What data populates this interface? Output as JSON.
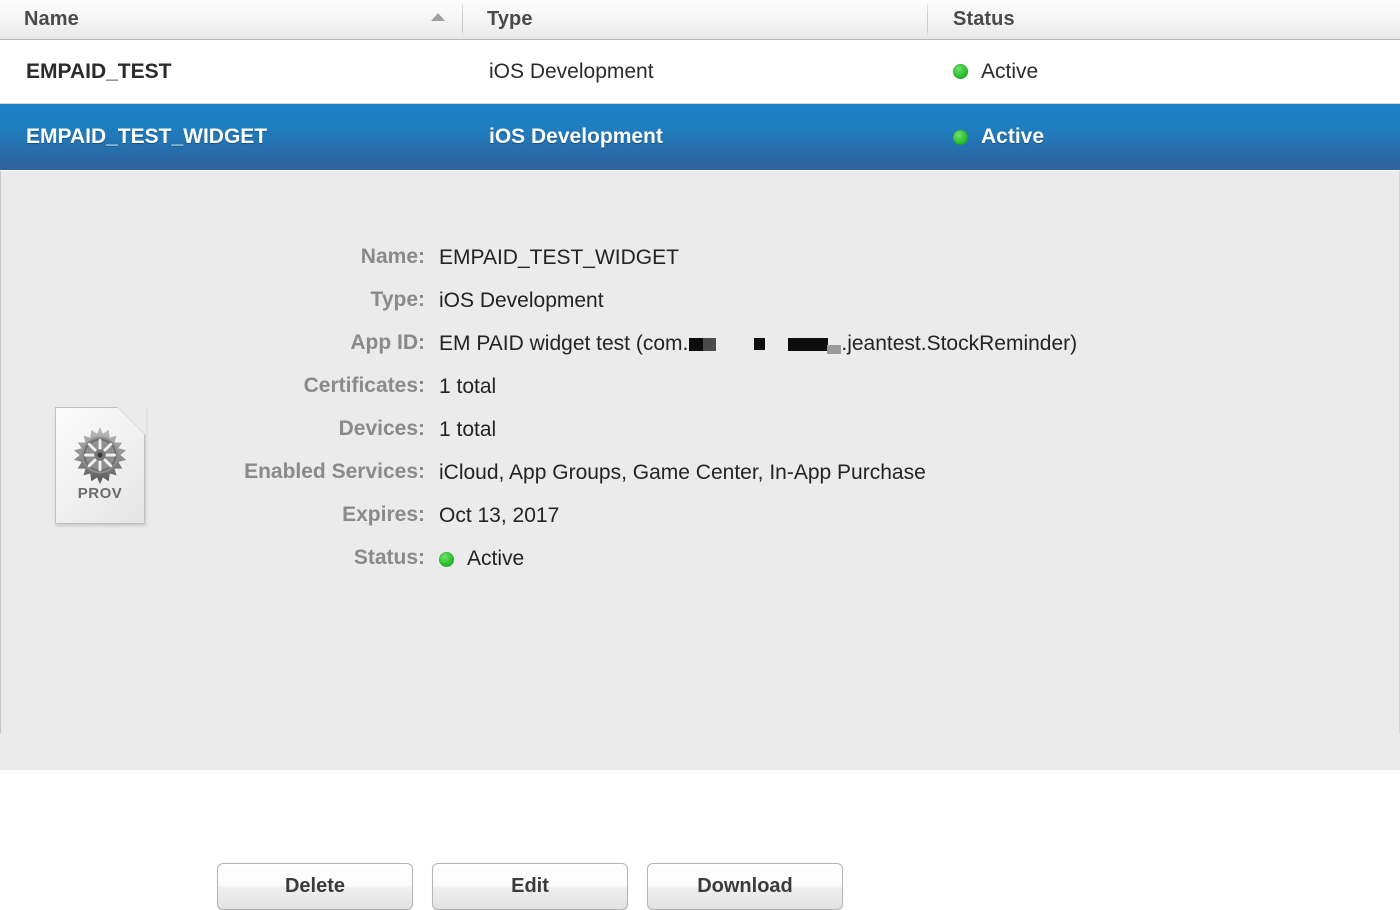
{
  "table": {
    "columns": [
      {
        "key": "name",
        "label": "Name",
        "sort": "ascending"
      },
      {
        "key": "type",
        "label": "Type"
      },
      {
        "key": "status",
        "label": "Status"
      }
    ],
    "rows": [
      {
        "name": "EMPAID_TEST",
        "type": "iOS Development",
        "status": "Active",
        "status_color": "#2dc02d",
        "selected": false
      },
      {
        "name": "EMPAID_TEST_WIDGET",
        "type": "iOS Development",
        "status": "Active",
        "status_color": "#2dc02d",
        "selected": true
      }
    ]
  },
  "detail": {
    "icon": {
      "badge": "PROV",
      "glyph": "gear-icon"
    },
    "fields": [
      {
        "label": "Name:",
        "value": "EMPAID_TEST_WIDGET"
      },
      {
        "label": "Type:",
        "value": "iOS Development"
      },
      {
        "label": "App ID:",
        "value": "EM PAID widget test (com.▮▮  ▮  ▮▮.jeantest.StockReminder)",
        "redacted": true,
        "prefix": "EM PAID widget test (com.",
        "suffix": ".jeantest.StockReminder)"
      },
      {
        "label": "Certificates:",
        "value": "1 total"
      },
      {
        "label": "Devices:",
        "value": "1 total"
      },
      {
        "label": "Enabled Services:",
        "value": "iCloud, App Groups, Game Center, In-App Purchase"
      },
      {
        "label": "Expires:",
        "value": "Oct 13, 2017"
      },
      {
        "label": "Status:",
        "value": "Active",
        "is_status": true,
        "status_color": "#2dc02d"
      }
    ],
    "buttons": [
      {
        "key": "delete",
        "label": "Delete"
      },
      {
        "key": "edit",
        "label": "Edit"
      },
      {
        "key": "download",
        "label": "Download"
      }
    ]
  },
  "colors": {
    "selection_blue_top": "#1982c8",
    "selection_blue_bottom": "#31639c",
    "panel_background": "#ebebeb",
    "status_green": "#2dc02d",
    "header_text": "#4a4a4a",
    "label_text": "#8a8a8a"
  }
}
